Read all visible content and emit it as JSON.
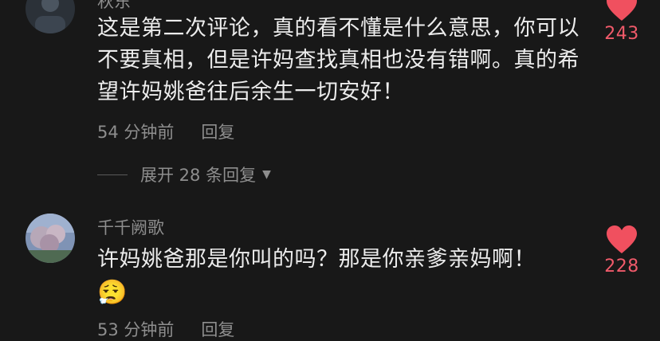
{
  "comments": [
    {
      "username": "秋东",
      "text": "这是第二次评论，真的看不懂是什么意思，你可以不要真相，但是许妈查找真相也没有错啊。真的希望许妈姚爸往后余生一切安好！",
      "time": "54 分钟前",
      "reply_label": "回复",
      "likes": "243"
    },
    {
      "username": "千千阙歌",
      "text": "许妈姚爸那是你叫的吗？那是你亲爹亲妈啊！",
      "emoji": "😮‍💨",
      "time": "53 分钟前",
      "reply_label": "回复",
      "likes": "228"
    }
  ],
  "expand_replies": "展开 28 条回复",
  "colors": {
    "background": "#181818",
    "like_heart": "#f0505f",
    "like_count": "#f05a6a",
    "secondary_text": "#8e8e8e"
  }
}
